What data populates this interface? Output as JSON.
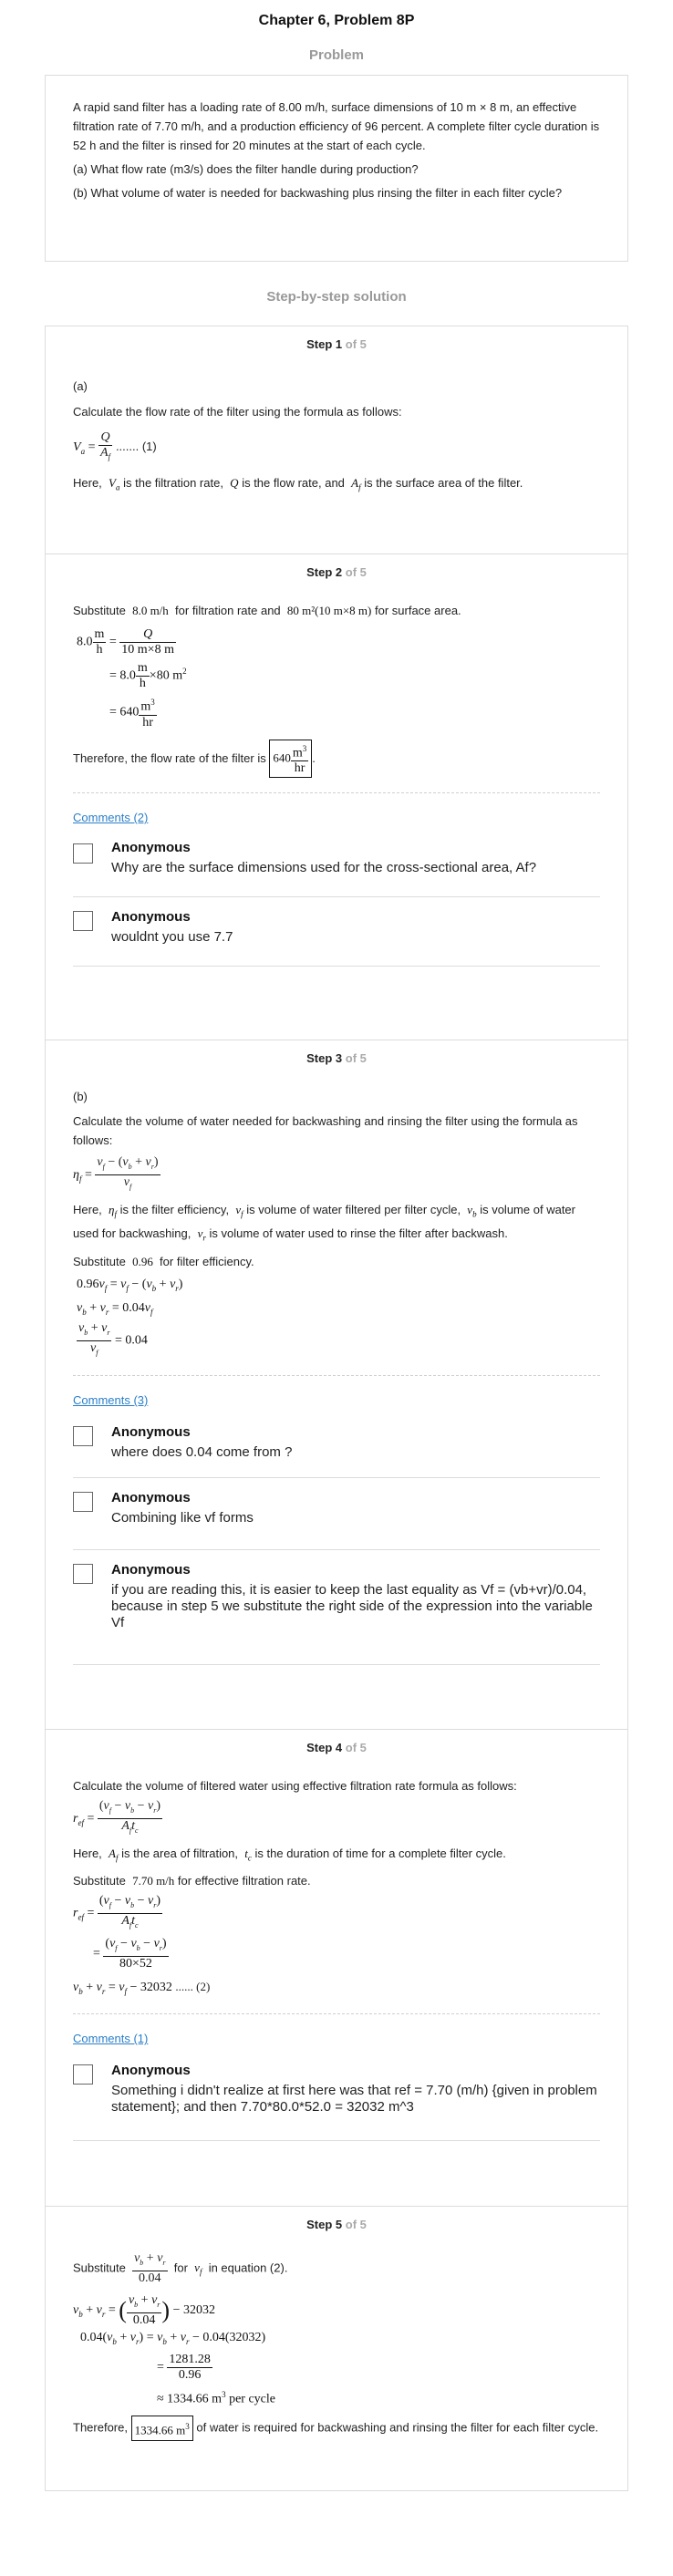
{
  "header": {
    "title": "Chapter 6, Problem 8P"
  },
  "problem": {
    "heading": "Problem",
    "p1": "A rapid sand filter has a loading rate of 8.00 m/h, surface dimensions of 10 m × 8 m, an effective filtration rate of 7.70 m/h, and a production efficiency of 96 percent. A complete filter cycle duration is 52 h and the filter is rinsed for 20 minutes at the start of each cycle.",
    "qa": "(a) What flow rate (m3/s) does the filter handle during production?",
    "qb": "(b) What volume of water is needed for backwashing plus rinsing the filter in each filter cycle?"
  },
  "solution": {
    "heading": "Step-by-step solution"
  },
  "step_label": "Step",
  "of_label": "of 5",
  "steps": {
    "s1": {
      "num": "1",
      "part": "(a)",
      "intro": "Calculate the flow rate of the filter using the formula as follows:",
      "eq_tag": "....... (1)",
      "here": "Here,",
      "desc1": "is the filtration rate,",
      "desc2": "is the flow rate, and",
      "desc3": "is the surface area of the filter."
    },
    "s2": {
      "num": "2",
      "sub_a": "Substitute",
      "val_rate": "8.0 m/h",
      "sub_b": "for filtration rate and",
      "val_area": "80 m²(10 m×8 m)",
      "sub_c": "for surface area.",
      "therefore": "Therefore, the flow rate of the filter is",
      "result": "640",
      "comments": "Comments (2)",
      "c1_author": "Anonymous",
      "c1_text": "Why are the surface dimensions used for the cross-sectional area, Af?",
      "c2_author": "Anonymous",
      "c2_text": "wouldnt you use 7.7"
    },
    "s3": {
      "num": "3",
      "part": "(b)",
      "intro": "Calculate the volume of water needed for backwashing and rinsing the filter using the formula as follows:",
      "here": "Here,",
      "d1": "is the filter efficiency,",
      "d2": "is volume of water filtered per filter cycle,",
      "d3": "is volume",
      "d4": "of water used for backwashing,",
      "d5": "is volume of water used to rinse the filter after backwash.",
      "sub": "Substitute",
      "sub_val": "0.96",
      "sub_rest": "for filter efficiency.",
      "comments": "Comments (3)",
      "c1_author": "Anonymous",
      "c1_text": "where does 0.04 come from ?",
      "c2_author": "Anonymous",
      "c2_text": "Combining like vf forms",
      "c3_author": "Anonymous",
      "c3_text": "if you are reading this, it is easier to keep the last equality as Vf = (vb+vr)/0.04, because in step 5 we substitute the right side of the expression into the variable Vf"
    },
    "s4": {
      "num": "4",
      "intro": "Calculate the volume of filtered water using effective filtration rate formula as follows:",
      "here": "Here,",
      "d1": "is the area of filtration,",
      "d2": "is the duration of time for a complete filter cycle.",
      "sub": "Substitute",
      "sub_val": "7.70 m/h",
      "sub_rest": "for effective filtration rate.",
      "eq_tag": "...... (2)",
      "comments": "Comments (1)",
      "c1_author": "Anonymous",
      "c1_text": "Something i didn't realize at first here was that ref = 7.70 (m/h) {given in problem statement}; and then 7.70*80.0*52.0 = 32032 m^3"
    },
    "s5": {
      "num": "5",
      "sub": "Substitute",
      "for": "for",
      "in_eq": "in equation (2).",
      "per_cycle": "per cycle",
      "therefore": "Therefore,",
      "result": "1334.66 m",
      "rest": "of water is required for backwashing and rinsing the filter for each filter cycle."
    }
  }
}
